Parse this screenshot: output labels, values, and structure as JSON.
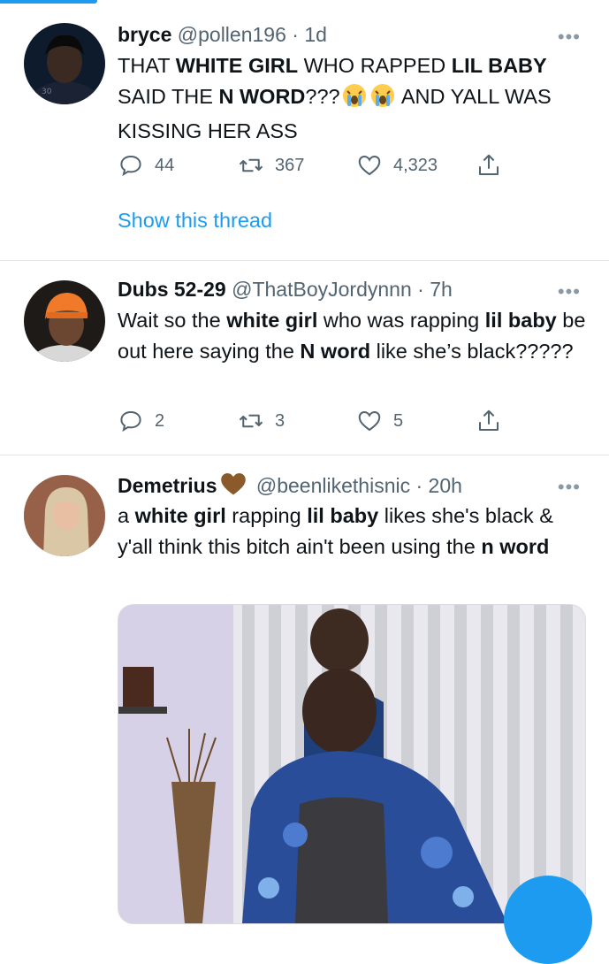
{
  "tweets": [
    {
      "name": "bryce",
      "handle": "@pollen196",
      "dot": "·",
      "time": "1d",
      "text_parts": [
        "THAT ",
        "WHITE GIRL",
        " WHO RAPPED ",
        "LIL BABY",
        " SAID THE ",
        "N WORD",
        "???",
        " AND YALL WAS KISSING HER ASS"
      ],
      "emoji": [
        "loudly-crying-face",
        "loudly-crying-face"
      ],
      "replies": "44",
      "retweets": "367",
      "likes": "4,323",
      "thread_link": "Show this thread"
    },
    {
      "name": "Dubs 52-29",
      "handle": "@ThatBoyJordynnn",
      "dot": "·",
      "time": "7h",
      "text_parts": [
        "Wait so the ",
        "white girl",
        " who was rapping ",
        "lil baby",
        " be out here saying the ",
        "N word",
        " like she’s black?????"
      ],
      "replies": "2",
      "retweets": "3",
      "likes": "5"
    },
    {
      "name": "Demetrius",
      "name_emoji": "brown-heart",
      "handle": "@beenlikethisnic",
      "dot": "·",
      "time": "20h",
      "text_parts": [
        "a ",
        "white girl",
        " rapping ",
        "lil baby",
        " likes she's black & y'all think this bitch ain't been using the ",
        "n word"
      ]
    }
  ],
  "more_label": "•••",
  "colors": {
    "accent": "#1d9bf0",
    "secondary_text": "#536471",
    "separator": "#e6e6e6"
  }
}
